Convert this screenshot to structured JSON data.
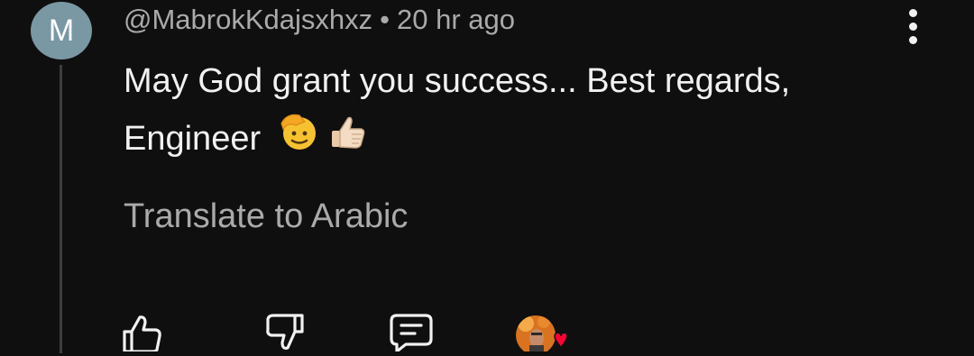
{
  "comment": {
    "avatar_letter": "M",
    "avatar_color": "#7a97a4",
    "author": "@MabrokKdajsxhxz",
    "separator": "•",
    "time": "20 hr ago",
    "text": "May God grant you success... Best regards, Engineer",
    "emojis": [
      "saluting-face-emoji",
      "thumbs-up-emoji"
    ],
    "translate_label": "Translate to Arabic"
  },
  "actions": {
    "like_icon": "thumbs-up-icon",
    "dislike_icon": "thumbs-down-icon",
    "reply_icon": "comment-icon",
    "creator_heart_icon": "creator-heart-icon",
    "heart_color": "#ff0033"
  },
  "theme": {
    "background": "#0f0f0f",
    "primary_text": "#f1f1f1",
    "secondary_text": "#aaaaaa"
  }
}
